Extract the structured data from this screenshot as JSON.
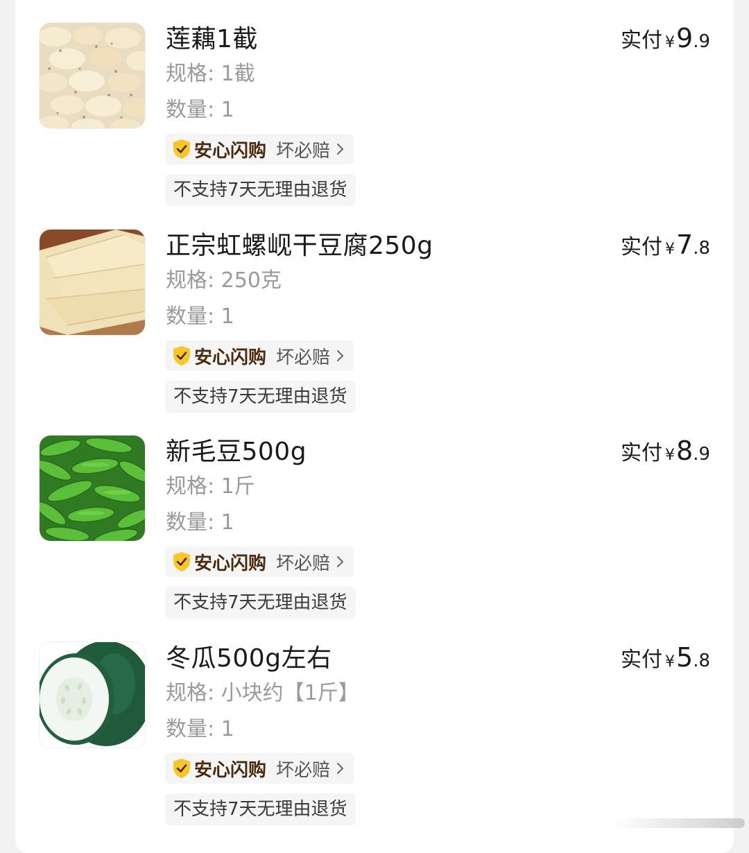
{
  "items": [
    {
      "title": "莲藕1截",
      "spec": "规格: 1截",
      "qty": "数量: 1",
      "price_label": "实付",
      "currency": "¥",
      "price_int": "9",
      "price_dec": ".9",
      "guarantee_main": "安心闪购",
      "guarantee_sub": "坏必赔",
      "no_return": "不支持7天无理由退货",
      "image": "lotus-root-icon"
    },
    {
      "title": "正宗虹螺岘干豆腐250g",
      "spec": "规格: 250克",
      "qty": "数量: 1",
      "price_label": "实付",
      "currency": "¥",
      "price_int": "7",
      "price_dec": ".8",
      "guarantee_main": "安心闪购",
      "guarantee_sub": "坏必赔",
      "no_return": "不支持7天无理由退货",
      "image": "dried-tofu-icon"
    },
    {
      "title": "新毛豆500g",
      "spec": "规格: 1斤",
      "qty": "数量: 1",
      "price_label": "实付",
      "currency": "¥",
      "price_int": "8",
      "price_dec": ".9",
      "guarantee_main": "安心闪购",
      "guarantee_sub": "坏必赔",
      "no_return": "不支持7天无理由退货",
      "image": "edamame-icon"
    },
    {
      "title": "冬瓜500g左右",
      "spec": "规格: 小块约【1斤】",
      "qty": "数量: 1",
      "price_label": "实付",
      "currency": "¥",
      "price_int": "5",
      "price_dec": ".8",
      "guarantee_main": "安心闪购",
      "guarantee_sub": "坏必赔",
      "no_return": "不支持7天无理由退货",
      "image": "winter-melon-icon"
    }
  ],
  "colors": {
    "guarantee_text": "#4a2a0c",
    "shield_fill": "#f7c72a",
    "muted_text": "#9a9a9a",
    "tag_bg": "#f5f5f5"
  }
}
